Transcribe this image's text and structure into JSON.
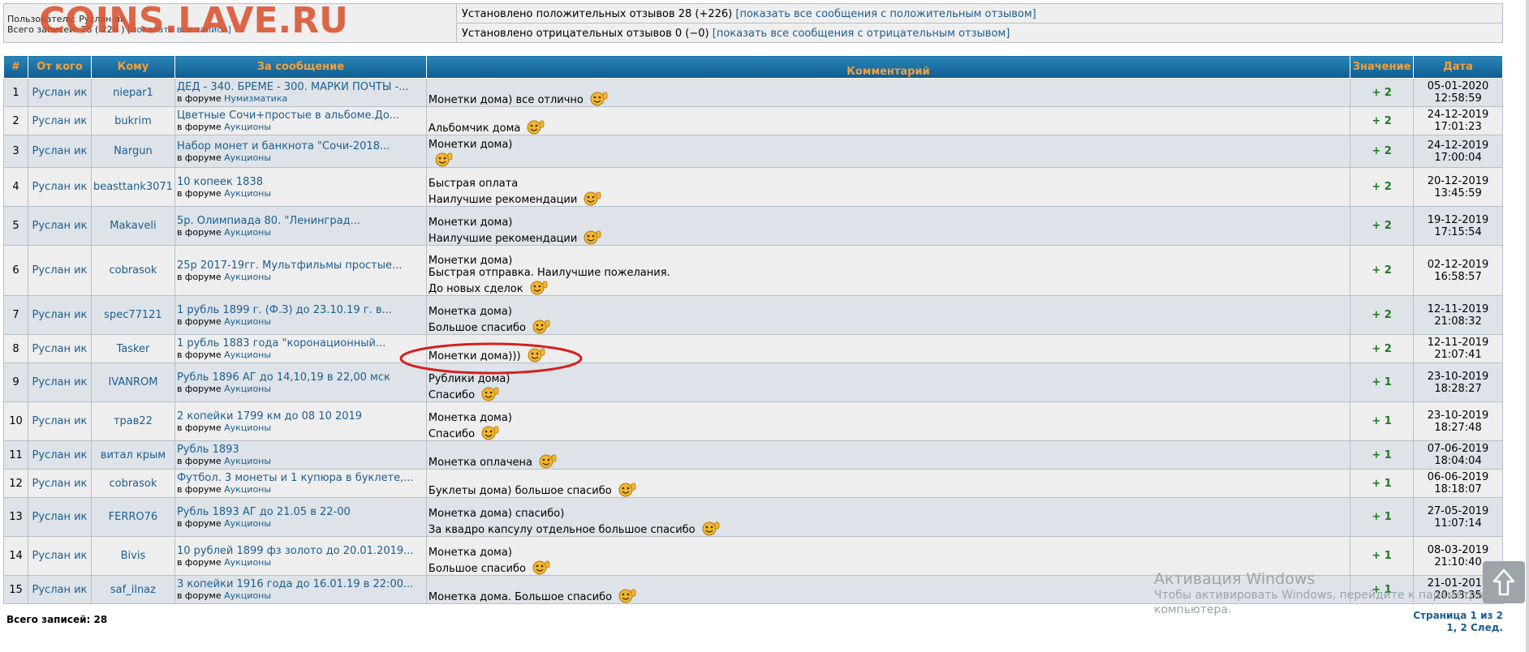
{
  "watermark": "COINS.LAVE.RU",
  "info": {
    "user_label": "Пользователь: Руслан ик",
    "total_label": "Всего записей: 28 ( 226 )",
    "show_all": "[показать все записи]",
    "positive_text": "Установлено положительных отзывов 28 (+226)",
    "positive_link": "[показать все сообщения с положительным отзывом]",
    "negative_text": "Установлено отрицательных отзывов 0 (−0)",
    "negative_link": "[показать все сообщения с отрицательным отзывом]"
  },
  "table": {
    "headers": [
      "#",
      "От кого",
      "Кому",
      "За сообщение",
      "Комментарий",
      "Значение",
      "Дата"
    ],
    "forum_prefix": "в форуме",
    "rows": [
      {
        "num": "1",
        "from": "Руслан ик",
        "to": "niepar1",
        "title": "ДЕД - 340. БРЕМЕ - 300. МАРКИ ПОЧТЫ -...",
        "forum": "Нумизматика",
        "comment": [
          "Монетки дома) все отлично"
        ],
        "value": "+ 2",
        "date": "05-01-2020",
        "time": "12:58:59"
      },
      {
        "num": "2",
        "from": "Руслан ик",
        "to": "bukrim",
        "title": "Цветные Сочи+простые в альбоме.До...",
        "forum": "Аукционы",
        "comment": [
          "Альбомчик дома"
        ],
        "value": "+ 2",
        "date": "24-12-2019",
        "time": "17:01:23"
      },
      {
        "num": "3",
        "from": "Руслан ик",
        "to": "Nargun",
        "title": "Набор монет и банкнота \"Сочи-2018...",
        "forum": "Аукционы",
        "comment": [
          "Монетки дома)",
          ""
        ],
        "value": "+ 2",
        "date": "24-12-2019",
        "time": "17:00:04"
      },
      {
        "num": "4",
        "from": "Руслан ик",
        "to": "beasttank3071",
        "title": "10 копеек 1838",
        "forum": "Аукционы",
        "comment": [
          "Быстрая оплата",
          "Наилучшие рекомендации"
        ],
        "value": "+ 2",
        "date": "20-12-2019",
        "time": "13:45:59"
      },
      {
        "num": "5",
        "from": "Руслан ик",
        "to": "Makaveli",
        "title": "5р. Олимпиада 80. \"Ленинград...",
        "forum": "Аукционы",
        "comment": [
          "Монетки дома)",
          "Наилучшие рекомендации"
        ],
        "value": "+ 2",
        "date": "19-12-2019",
        "time": "17:15:54"
      },
      {
        "num": "6",
        "from": "Руслан ик",
        "to": "cobrasok",
        "title": "25р 2017-19гг. Мультфильмы простые...",
        "forum": "Аукционы",
        "comment": [
          "Монетки дома)",
          "Быстрая отправка. Наилучшие пожелания.",
          "До новых сделок"
        ],
        "value": "+ 2",
        "date": "02-12-2019",
        "time": "16:58:57"
      },
      {
        "num": "7",
        "from": "Руслан ик",
        "to": "spec77121",
        "title": "1 рубль 1899 г. (Ф.З) до 23.10.19 г. в...",
        "forum": "Аукционы",
        "comment": [
          "Монетка дома)",
          "Большое спасибо"
        ],
        "value": "+ 2",
        "date": "12-11-2019",
        "time": "21:08:32"
      },
      {
        "num": "8",
        "from": "Руслан ик",
        "to": "Tasker",
        "title": "1 рубль 1883 года \"коронационный...",
        "forum": "Аукционы",
        "comment": [
          "Монетки дома)))"
        ],
        "value": "+ 2",
        "date": "12-11-2019",
        "time": "21:07:41"
      },
      {
        "num": "9",
        "from": "Руслан ик",
        "to": "IVANROM",
        "title": "Рубль 1896 АГ до 14,10,19 в 22,00 мск",
        "forum": "Аукционы",
        "comment": [
          "Рублики дома)",
          "Спасибо"
        ],
        "value": "+ 1",
        "date": "23-10-2019",
        "time": "18:28:27"
      },
      {
        "num": "10",
        "from": "Руслан ик",
        "to": "трав22",
        "title": "2 копейки 1799 км до 08 10 2019",
        "forum": "Аукционы",
        "comment": [
          "Монетка дома)",
          "Спасибо"
        ],
        "value": "+ 1",
        "date": "23-10-2019",
        "time": "18:27:48"
      },
      {
        "num": "11",
        "from": "Руслан ик",
        "to": "витал крым",
        "title": "Рубль 1893",
        "forum": "Аукционы",
        "comment": [
          "Монетка оплачена"
        ],
        "value": "+ 1",
        "date": "07-06-2019",
        "time": "18:04:04"
      },
      {
        "num": "12",
        "from": "Руслан ик",
        "to": "cobrasok",
        "title": "Футбол. 3 монеты и 1 купюра в буклете,...",
        "forum": "Аукционы",
        "comment": [
          "Буклеты дома) большое спасибо"
        ],
        "value": "+ 1",
        "date": "06-06-2019",
        "time": "18:18:07"
      },
      {
        "num": "13",
        "from": "Руслан ик",
        "to": "FERRO76",
        "title": "Рубль 1893 АГ до 21.05 в 22-00",
        "forum": "Аукционы",
        "comment": [
          "Монетка дома) спасибо)",
          "За квадро капсулу отдельное большое спасибо"
        ],
        "value": "+ 1",
        "date": "27-05-2019",
        "time": "11:07:14"
      },
      {
        "num": "14",
        "from": "Руслан ик",
        "to": "Bivis",
        "title": "10 рублей 1899 фз золото до 20.01.2019...",
        "forum": "Аукционы",
        "comment": [
          "Монетка дома)",
          "Большое спасибо"
        ],
        "value": "+ 1",
        "date": "08-03-2019",
        "time": "21:10:40"
      },
      {
        "num": "15",
        "from": "Руслан ик",
        "to": "saf_ilnaz",
        "title": "3 копейки 1916 года до 16.01.19 в 22:00...",
        "forum": "Аукционы",
        "comment": [
          "Монетка дома. Большое спасибо"
        ],
        "value": "+ 1",
        "date": "21-01-2019",
        "time": "20:53:35"
      }
    ]
  },
  "footer": {
    "total": "Всего записей: 28",
    "page_label": "Страница 1 из 2",
    "pages": "1, 2  След."
  },
  "activation": {
    "title": "Активация Windows",
    "line1": "Чтобы активировать Windows, перейдите к параметрам",
    "line2": "компьютера."
  },
  "icons": {
    "smiley": "thumbs-up-smiley-icon",
    "scroll": "arrow-up-icon"
  },
  "colors": {
    "header_text": "#f3a13a",
    "header_bg": "#1a6fa4",
    "link": "#1d5e8f",
    "value": "#1e7a1e",
    "annotation": "#d42020"
  }
}
